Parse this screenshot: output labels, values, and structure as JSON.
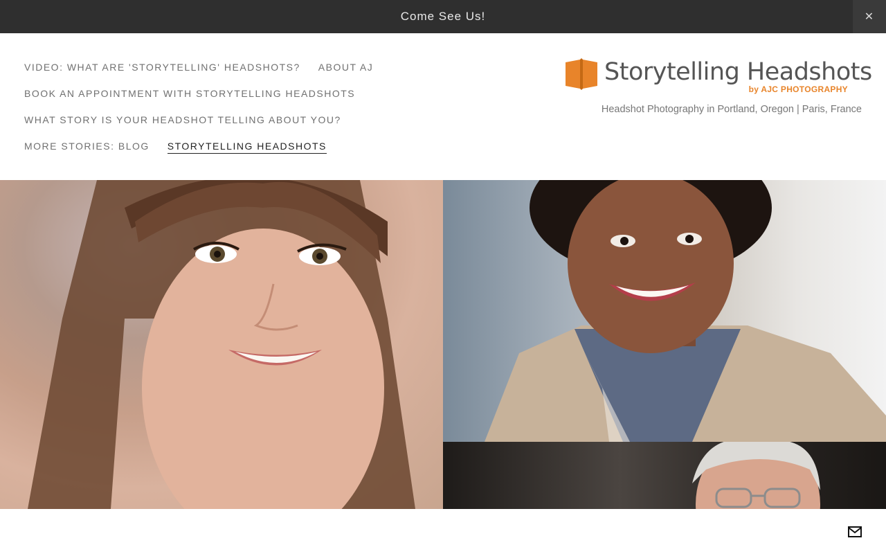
{
  "announcement": {
    "text": "Come See Us!",
    "close_glyph": "✕"
  },
  "nav": {
    "rows": [
      [
        "VIDEO: WHAT ARE 'STORYTELLING' HEADSHOTS?",
        "ABOUT AJ"
      ],
      [
        "BOOK AN APPOINTMENT WITH STORYTELLING HEADSHOTS"
      ],
      [
        "WHAT STORY IS YOUR HEADSHOT TELLING ABOUT YOU?"
      ],
      [
        "MORE STORIES: BLOG",
        "STORYTELLING HEADSHOTS"
      ]
    ],
    "active": "STORYTELLING HEADSHOTS"
  },
  "brand": {
    "title": "Storytelling Headshots",
    "subtitle": "by AJC PHOTOGRAPHY",
    "tagline": "Headshot Photography in Portland, Oregon | Paris, France",
    "logo_icon": "open-book-icon",
    "accent_color": "#e8842a"
  },
  "gallery": {
    "photos": [
      "headshot-woman-bangs",
      "headshot-woman-blazer",
      "headshot-man-glasses"
    ]
  },
  "footer": {
    "icon": "mail-icon"
  }
}
